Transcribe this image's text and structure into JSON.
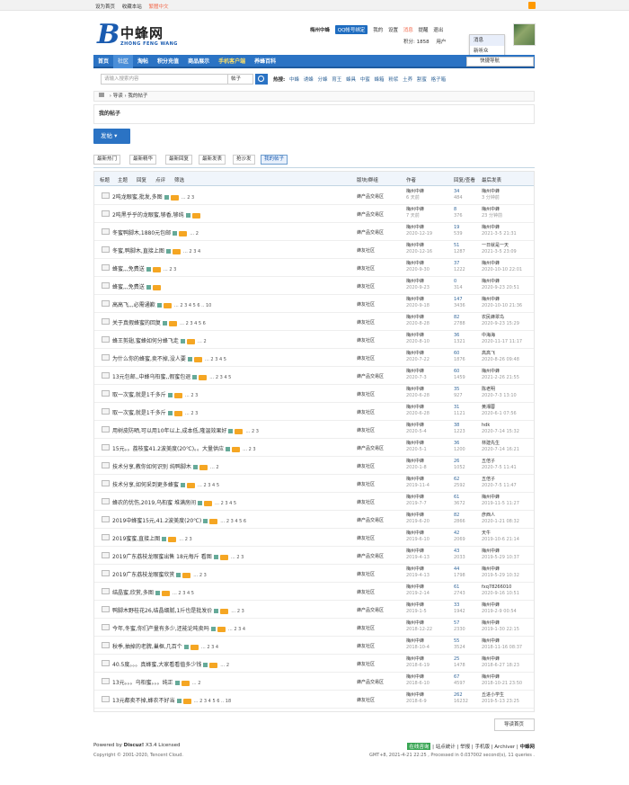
{
  "topbar": {
    "links": [
      "设为首页",
      "收藏本站"
    ],
    "lang": "繁體中文"
  },
  "logo": {
    "letter": "B",
    "cn": "中蜂网",
    "en": "ZHONG FENG WANG"
  },
  "user": {
    "name": "梅州中蜂",
    "qq": "QQ帐号绑定",
    "menu": [
      "我的",
      "设置",
      "消息",
      "提醒",
      "退出"
    ],
    "points": "积分: 1858",
    "group": "用户"
  },
  "popup": [
    "消息",
    "新听众"
  ],
  "nav": {
    "items": [
      "首页",
      "社区",
      "淘帖",
      "积分充值",
      "商品展示",
      "手机客户端",
      "养蜂百科"
    ],
    "active": 1,
    "right": "快捷导航"
  },
  "search": {
    "placeholder": "请输入搜索内容",
    "type": "帖子",
    "hot_label": "热搜:",
    "hot": [
      "中蜂",
      "诱蜂",
      "分蜂",
      "育王",
      "蜂具",
      "中蜜",
      "蜂箱",
      "粉浆",
      "土养",
      "割蜜",
      "格子箱"
    ]
  },
  "breadcrumb": [
    "导读",
    "我的帖子"
  ],
  "title": "我的帖子",
  "post_button": "发帖",
  "tabs": [
    "最新热门",
    "最新精华",
    "最新回复",
    "最新发表",
    "抢沙发",
    "我的帖子"
  ],
  "list_header": {
    "cols": [
      "标题",
      "主题",
      "回复",
      "点评",
      "筛选"
    ],
    "forum": "版块/群组",
    "author": "作者",
    "replies": "回复/查看",
    "last": "最后发表"
  },
  "threads": [
    {
      "title": "2吨龙眼蜜,批发,多图",
      "pages": "… 2 3",
      "forum": "蜂产品交易区",
      "author": "梅州中蜂",
      "date": "6 天前",
      "replies": "34",
      "views": "484",
      "last_user": "梅州中蜂",
      "last_date": "3 分钟前"
    },
    {
      "title": "2吨黑乎乎的龙眼蜜,够香,够纯",
      "pages": "",
      "forum": "蜂产品交易区",
      "author": "梅州中蜂",
      "date": "7 天前",
      "replies": "8",
      "views": "376",
      "last_user": "梅州中蜂",
      "last_date": "23 分钟前"
    },
    {
      "title": "冬蜜鸭脚木,1880元包邮",
      "pages": "… 2",
      "forum": "蜂产品交易区",
      "author": "梅州中蜂",
      "date": "2020-12-19",
      "replies": "19",
      "views": "539",
      "last_user": "梅州中蜂",
      "last_date": "2021-3-5 21:31"
    },
    {
      "title": "冬蜜,鸭脚木,直接上图",
      "pages": "… 2 3 4",
      "forum": "蜂友社区",
      "author": "梅州中蜂",
      "date": "2020-12-16",
      "replies": "51",
      "views": "1287",
      "last_user": "一日就是一天",
      "last_date": "2021-3-5 23:09"
    },
    {
      "title": "蜂蜜,,,免费送",
      "pages": "… 2 3",
      "forum": "蜂友社区",
      "author": "梅州中蜂",
      "date": "2020-9-30",
      "replies": "37",
      "views": "1222",
      "last_user": "梅州中蜂",
      "last_date": "2020-10-10 22:01"
    },
    {
      "title": "蜂蜜,,,免费送",
      "pages": "",
      "forum": "蜂友社区",
      "author": "梅州中蜂",
      "date": "2020-9-23",
      "replies": "0",
      "views": "314",
      "last_user": "梅州中蜂",
      "last_date": "2020-9-23 20:51"
    },
    {
      "title": "高高飞,,,必需通歉",
      "pages": "… 2 3 4 5 6 .. 10",
      "forum": "蜂友社区",
      "author": "梅州中蜂",
      "date": "2020-9-18",
      "replies": "147",
      "views": "3436",
      "last_user": "梅州中蜂",
      "last_date": "2020-10-10 21:36"
    },
    {
      "title": "关于真假蜂蜜的回复",
      "pages": "… 2 3 4 5 6",
      "forum": "蜂友社区",
      "author": "梅州中蜂",
      "date": "2020-8-28",
      "replies": "82",
      "views": "2788",
      "last_user": "农民蜂翠鸟",
      "last_date": "2020-9-23 15:29"
    },
    {
      "title": "蜂王剪翅,蜜蜂如何分蜂飞走",
      "pages": "… 2",
      "forum": "蜂友社区",
      "author": "梅州中蜂",
      "date": "2020-8-10",
      "replies": "36",
      "views": "1321",
      "last_user": "中海海",
      "last_date": "2020-11-17 11:17"
    },
    {
      "title": "为什么你的蜂蜜,卖不掉,没人要",
      "pages": "… 2 3 4 5",
      "forum": "蜂友社区",
      "author": "梅州中蜂",
      "date": "2020-7-22",
      "replies": "60",
      "views": "1876",
      "last_user": "高高飞",
      "last_date": "2020-8-26 09:48"
    },
    {
      "title": "13元包邮,,中蜂乌桕蜜,,假蜜包退",
      "pages": "… 2 3 4 5",
      "forum": "蜂产品交易区",
      "author": "梅州中蜂",
      "date": "2020-7-3",
      "replies": "60",
      "views": "1459",
      "last_user": "梅州中蜂",
      "last_date": "2021-2-26 21:55"
    },
    {
      "title": "取一次蜜,就是1千多斤",
      "pages": "… 2 3",
      "forum": "蜂友社区",
      "author": "梅州中蜂",
      "date": "2020-6-28",
      "replies": "35",
      "views": "927",
      "last_user": "陈老明",
      "last_date": "2020-7-3 13:10"
    },
    {
      "title": "取一次蜜,就是1千多斤",
      "pages": "… 2 3",
      "forum": "蜂友社区",
      "author": "梅州中蜂",
      "date": "2020-6-28",
      "replies": "31",
      "views": "1121",
      "last_user": "黄湘蓉",
      "last_date": "2020-6-1 07:56"
    },
    {
      "title": "用树皮防晒,可以用10年以上,成本低,隆温效果好",
      "pages": "… 2 3",
      "forum": "蜂友社区",
      "author": "梅州中蜂",
      "date": "2020-5-4",
      "replies": "38",
      "views": "1223",
      "last_user": "hdk",
      "last_date": "2020-7-14 15:32"
    },
    {
      "title": "15元。。荔枝蜜41.2波美度(20℃)。。大量供应",
      "pages": "… 2 3",
      "forum": "蜂产品交易区",
      "author": "梅州中蜂",
      "date": "2020-5-1",
      "replies": "36",
      "views": "1200",
      "last_user": "林建先生",
      "last_date": "2020-7-14 16:21"
    },
    {
      "title": "技术分享,教你如何识别 纯鸭脚木",
      "pages": "… 2",
      "forum": "蜂友社区",
      "author": "梅州中蜂",
      "date": "2020-1-8",
      "replies": "26",
      "views": "1052",
      "last_user": "五倍子",
      "last_date": "2020-7-5 11:41"
    },
    {
      "title": "技术分享,如何采到更多蜂蜜",
      "pages": "… 2 3 4 5",
      "forum": "蜂友社区",
      "author": "梅州中蜂",
      "date": "2019-11-4",
      "replies": "62",
      "views": "2592",
      "last_user": "五倍子",
      "last_date": "2020-7-5 11:47"
    },
    {
      "title": "蜂农的忧伤,2019,乌桕蜜 堆满房间",
      "pages": "… 2 3 4 5",
      "forum": "蜂友社区",
      "author": "梅州中蜂",
      "date": "2019-7-7",
      "replies": "61",
      "views": "3672",
      "last_user": "梅州中蜂",
      "last_date": "2019-11-5 11:27"
    },
    {
      "title": "2019中蜂蜜15元,41.2波美度(20℃)",
      "pages": "… 2 3 4 5 6",
      "forum": "蜂产品交易区",
      "author": "梅州中蜂",
      "date": "2019-6-20",
      "replies": "82",
      "views": "2866",
      "last_user": "彦西人",
      "last_date": "2020-1-21 08:32"
    },
    {
      "title": "2019蜜蜜,直接上图",
      "pages": "… 2 3",
      "forum": "蜂友社区",
      "author": "梅州中蜂",
      "date": "2019-6-10",
      "replies": "42",
      "views": "2069",
      "last_user": "天牛",
      "last_date": "2019-10-6 21:14"
    },
    {
      "title": "2019广东荔枝龙眼蜜出售 18元每斤 看图",
      "pages": "… 2 3",
      "forum": "蜂产品交易区",
      "author": "梅州中蜂",
      "date": "2019-4-13",
      "replies": "43",
      "views": "2033",
      "last_user": "梅州中蜂",
      "last_date": "2019-5-29 10:37"
    },
    {
      "title": "2019广东荔枝龙眼蜜欣赏",
      "pages": "… 2 3",
      "forum": "蜂友社区",
      "author": "梅州中蜂",
      "date": "2019-4-13",
      "replies": "44",
      "views": "1798",
      "last_user": "梅州中蜂",
      "last_date": "2019-5-29 10:32"
    },
    {
      "title": "结晶蜜,欣赏,多图",
      "pages": "… 2 3 4 5",
      "forum": "蜂友社区",
      "author": "梅州中蜂",
      "date": "2019-2-14",
      "replies": "61",
      "views": "2743",
      "last_user": "fxq78266010",
      "last_date": "2020-9-16 10:51"
    },
    {
      "title": "鸭脚木野桂花26,结晶细腻,1斤也是批发价",
      "pages": "… 2 3",
      "forum": "蜂产品交易区",
      "author": "梅州中蜂",
      "date": "2019-1-5",
      "replies": "33",
      "views": "1942",
      "last_user": "梅州中蜂",
      "last_date": "2019-2-9 00:54"
    },
    {
      "title": "今年,冬蜜,你们产量有多少,还能论吨卖吗",
      "pages": "… 2 3 4",
      "forum": "蜂友社区",
      "author": "梅州中蜂",
      "date": "2018-12-22",
      "replies": "57",
      "views": "2330",
      "last_user": "梅州中蜂",
      "last_date": "2019-1-30 22:15"
    },
    {
      "title": "秋季,抽掉的老脾,巢框,几百个",
      "pages": "… 2 3 4",
      "forum": "蜂友社区",
      "author": "梅州中蜂",
      "date": "2018-10-4",
      "replies": "55",
      "views": "3524",
      "last_user": "梅州中蜂",
      "last_date": "2018-11-16 08:37"
    },
    {
      "title": "40.5度。。。真蜂蜜,大家看看值多少钱",
      "pages": "… 2",
      "forum": "蜂友社区",
      "author": "梅州中蜂",
      "date": "2018-6-19",
      "replies": "25",
      "views": "1478",
      "last_user": "梅州中蜂",
      "last_date": "2018-6-27 18:23"
    },
    {
      "title": "13元。。。乌桕蜜。。。纯正",
      "pages": "… 2",
      "forum": "蜂产品交易区",
      "author": "梅州中蜂",
      "date": "2018-6-10",
      "replies": "67",
      "views": "4597",
      "last_user": "梅州中蜂",
      "last_date": "2018-10-21 23:50"
    },
    {
      "title": "13元都卖不掉,蜂农不好当",
      "pages": "… 2 3 4 5 6 .. 18",
      "forum": "蜂友社区",
      "author": "梅州中蜂",
      "date": "2018-6-9",
      "replies": "262",
      "views": "16232",
      "last_user": "丘进小学生",
      "last_date": "2019-5-13 23:25"
    }
  ],
  "back_button": "导读首页",
  "footer": {
    "powered": "Powered by",
    "product": "Discuz!",
    "version": "X3.4 Licensed",
    "copyright": "Copyright © 2001-2020, Tencent Cloud.",
    "badge": "在线咨询",
    "links": "| 站点统计 | 举报 | 手机版 | Archiver |",
    "site": "中蜂网",
    "stats": "GMT+8, 2021-4-21 22:25 , Processed in 0.037002 second(s), 11 queries ."
  }
}
